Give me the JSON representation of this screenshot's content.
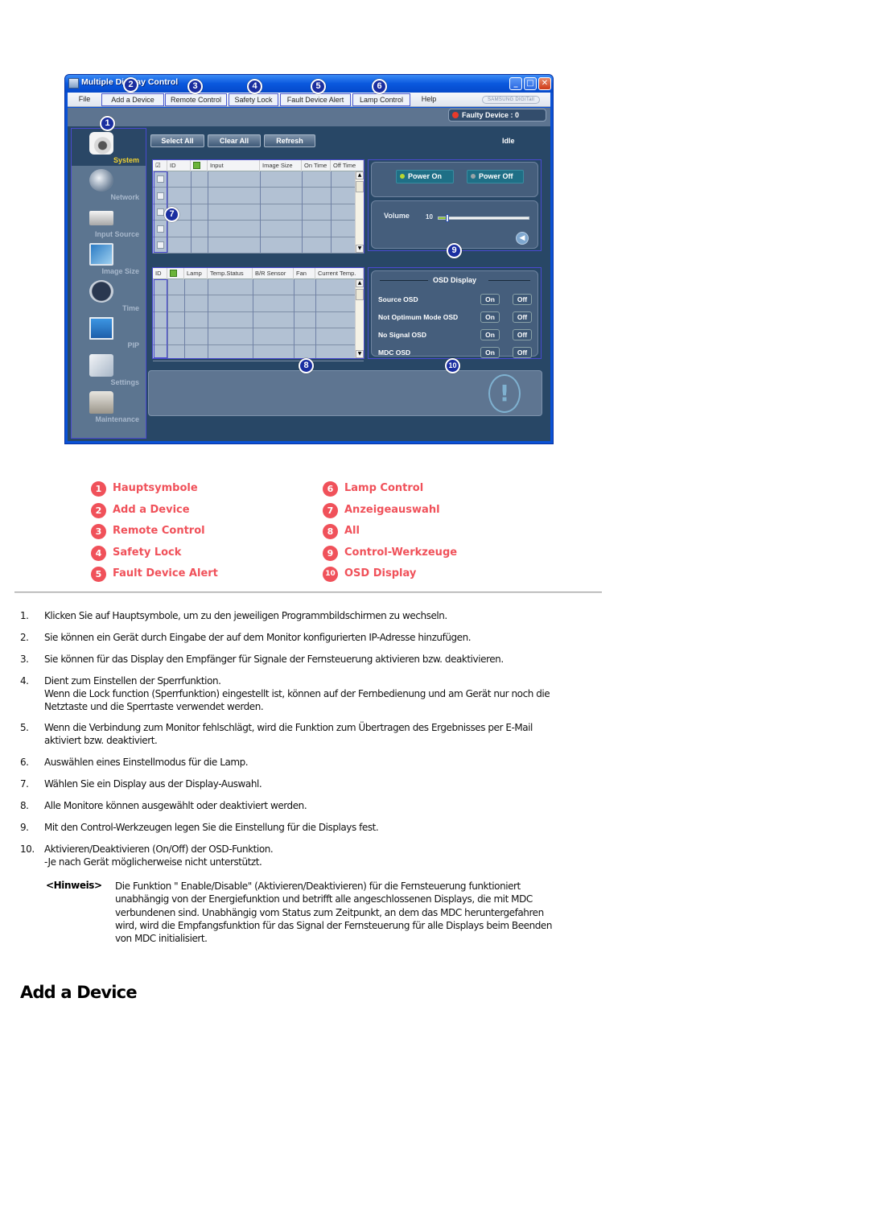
{
  "window": {
    "title": "Multiple Display Control",
    "controls": {
      "minimize": "_",
      "maximize": "□",
      "close": "✕"
    },
    "menu": [
      {
        "label": "File",
        "callout": null
      },
      {
        "label": "Add a Device",
        "callout": "2"
      },
      {
        "label": "Remote Control",
        "callout": "3"
      },
      {
        "label": "Safety Lock",
        "callout": "4"
      },
      {
        "label": "Fault Device Alert",
        "callout": "5"
      },
      {
        "label": "Lamp Control",
        "callout": "6"
      },
      {
        "label": "Help",
        "callout": null
      }
    ],
    "brand_logo": "SAMSUNG DIGITall",
    "faulty_device": "Faulty Device : 0",
    "status": "Idle",
    "toolbar": {
      "select_all": "Select All",
      "clear_all": "Clear All",
      "refresh": "Refresh"
    },
    "sidebar": [
      {
        "label": "System",
        "icon": "power-camera-icon",
        "active": true
      },
      {
        "label": "Network",
        "icon": "globe-icon",
        "active": false
      },
      {
        "label": "Input Source",
        "icon": "input-box-icon",
        "active": false
      },
      {
        "label": "Image Size",
        "icon": "monitor-icon",
        "active": false
      },
      {
        "label": "Time",
        "icon": "clock-icon",
        "active": false
      },
      {
        "label": "PIP",
        "icon": "pip-screen-icon",
        "active": false
      },
      {
        "label": "Settings",
        "icon": "settings-cube-icon",
        "active": false
      },
      {
        "label": "Maintenance",
        "icon": "joystick-icon",
        "active": false
      }
    ],
    "display_grid": {
      "columns": [
        "☑",
        "ID",
        "power",
        "Input",
        "Image  Size",
        "On Time",
        "Off Time"
      ],
      "row_count": 5
    },
    "status_grid": {
      "columns": [
        "ID",
        "power",
        "Lamp",
        "Temp.Status",
        "B/R Sensor",
        "Fan",
        "Current Temp."
      ],
      "row_count": 5
    },
    "power": {
      "on_label": "Power On",
      "off_label": "Power Off"
    },
    "volume": {
      "label": "Volume",
      "value": "10",
      "level_fraction": 0.1
    },
    "osd": {
      "title": "OSD Display",
      "rows": [
        {
          "label": "Source OSD",
          "on": "On",
          "off": "Off"
        },
        {
          "label": "Not Optimum Mode OSD",
          "on": "On",
          "off": "Off"
        },
        {
          "label": "No Signal OSD",
          "on": "On",
          "off": "Off"
        },
        {
          "label": "MDC OSD",
          "on": "On",
          "off": "Off"
        }
      ]
    },
    "callouts": [
      "1",
      "2",
      "3",
      "4",
      "5",
      "6",
      "7",
      "8",
      "9",
      "10"
    ]
  },
  "legend": {
    "color": "#f0515a",
    "items": [
      {
        "num": "1",
        "label": "Hauptsymbole"
      },
      {
        "num": "2",
        "label": "Add a Device"
      },
      {
        "num": "3",
        "label": "Remote Control"
      },
      {
        "num": "4",
        "label": "Safety Lock"
      },
      {
        "num": "5",
        "label": "Fault Device Alert"
      },
      {
        "num": "6",
        "label": "Lamp Control"
      },
      {
        "num": "7",
        "label": "Anzeigeauswahl"
      },
      {
        "num": "8",
        "label": "All"
      },
      {
        "num": "9",
        "label": "Control-Werkzeuge"
      },
      {
        "num": "10",
        "label": "OSD Display"
      }
    ]
  },
  "steps": [
    {
      "num": "1.",
      "lines": [
        "Klicken Sie auf Hauptsymbole, um zu den jeweiligen Programmbildschirmen zu wechseln."
      ]
    },
    {
      "num": "2.",
      "lines": [
        "Sie können ein Gerät durch Eingabe der auf dem Monitor konfigurierten IP-Adresse hinzufügen."
      ]
    },
    {
      "num": "3.",
      "lines": [
        "Sie können für das Display den Empfänger für Signale der Fernsteuerung aktivieren bzw. deaktivieren."
      ]
    },
    {
      "num": "4.",
      "lines": [
        "Dient zum Einstellen der Sperrfunktion.",
        "Wenn die Lock function (Sperrfunktion) eingestellt ist, können auf der Fernbedienung und am Gerät nur noch die",
        "Netztaste und die Sperrtaste verwendet werden."
      ]
    },
    {
      "num": "5.",
      "lines": [
        "Wenn die Verbindung zum Monitor fehlschlägt, wird die Funktion zum Übertragen des Ergebnisses per E-Mail",
        "aktiviert bzw. deaktiviert."
      ]
    },
    {
      "num": "6.",
      "lines": [
        "Auswählen eines Einstellmodus für die Lamp."
      ]
    },
    {
      "num": "7.",
      "lines": [
        "Wählen Sie ein Display aus der Display-Auswahl."
      ]
    },
    {
      "num": "8.",
      "lines": [
        "Alle Monitore können ausgewählt oder deaktiviert werden."
      ]
    },
    {
      "num": "9.",
      "lines": [
        "Mit den Control-Werkzeugen legen Sie die Einstellung für die Displays fest."
      ]
    },
    {
      "num": "10.",
      "lines": [
        "Aktivieren/Deaktivieren (On/Off) der OSD-Funktion.",
        "-Je nach Gerät möglicherweise nicht unterstützt."
      ]
    }
  ],
  "note": {
    "label": "<Hinweis>",
    "lines": [
      "Die Funktion \" Enable/Disable\" (Aktivieren/Deaktivieren) für die Fernsteuerung funktioniert",
      "unabhängig von der Energiefunktion und betrifft alle angeschlossenen Displays, die mit MDC",
      "verbundenen sind. Unabhängig vom Status zum Zeitpunkt, an dem das MDC heruntergefahren",
      "wird, wird die Empfangsfunktion für das Signal der Fernsteuerung für alle Displays beim Beenden",
      "von MDC initialisiert."
    ]
  },
  "section_title": "Add a Device"
}
